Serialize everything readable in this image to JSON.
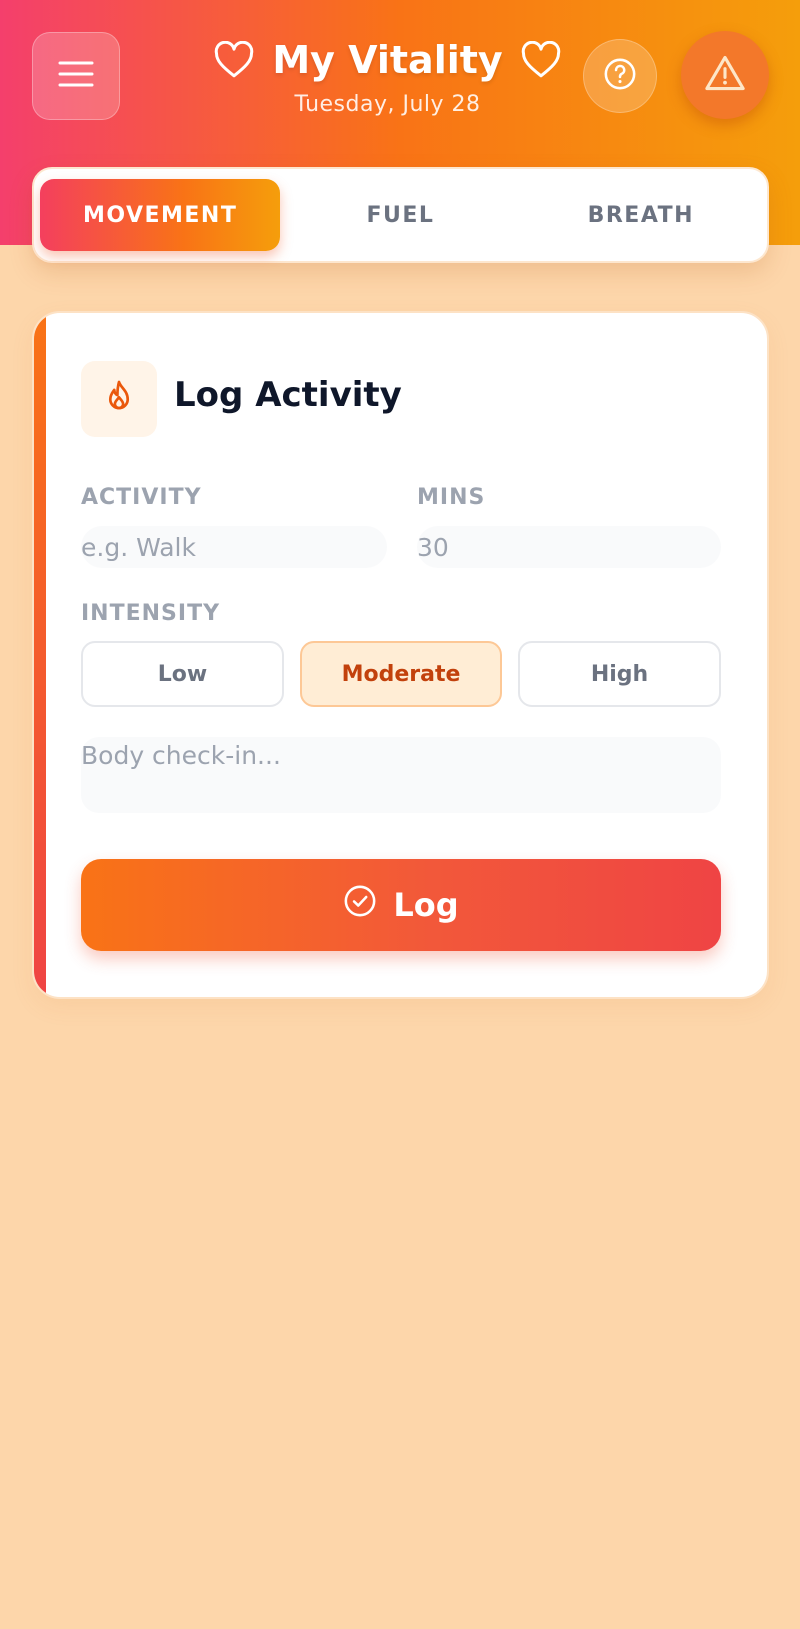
{
  "header": {
    "title": "My Vitality",
    "subtitle": "Tuesday, July 28",
    "menu_icon": "hamburger-menu-icon",
    "help_icon": "question-circle-icon",
    "alert_icon": "warning-triangle-icon",
    "heart_icon": "heart-outline-icon"
  },
  "tabs": [
    {
      "label": "MOVEMENT",
      "active": true
    },
    {
      "label": "FUEL",
      "active": false
    },
    {
      "label": "BREATH",
      "active": false
    }
  ],
  "card": {
    "icon": "flame-icon",
    "title": "Log Activity",
    "activity_label": "ACTIVITY",
    "activity_placeholder": "e.g. Walk",
    "mins_label": "MINS",
    "mins_placeholder": "30",
    "intensity_label": "INTENSITY",
    "intensity_options": [
      "Low",
      "Moderate",
      "High"
    ],
    "intensity_selected": "Moderate",
    "notes_placeholder": "Body check-in...",
    "submit_label": "Log",
    "submit_icon": "check-circle-icon"
  },
  "colors": {
    "background": "#fdd6aa",
    "accent_orange": "#f97316",
    "accent_red": "#ef4444",
    "accent_pink": "#f43f5e",
    "selected_text": "#c2410c"
  }
}
